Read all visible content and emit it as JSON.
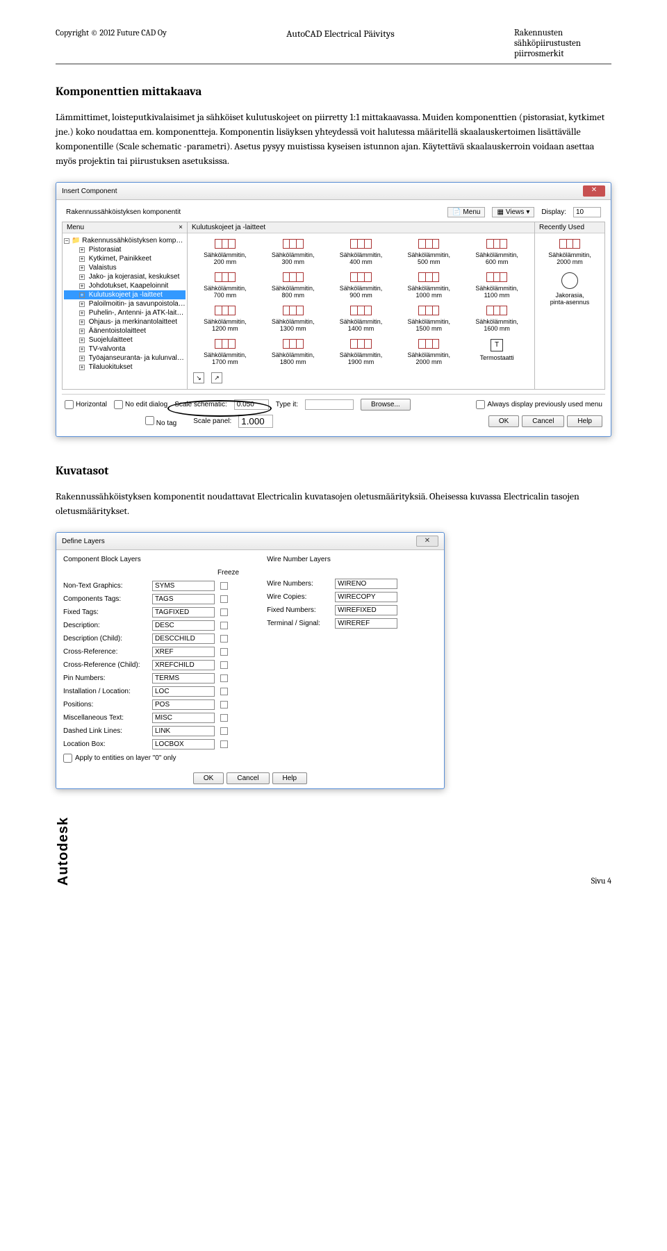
{
  "header": {
    "copyright": "Copyright © 2012 Future CAD Oy",
    "title": "AutoCAD Electrical Päivitys",
    "subtitle": "Rakennusten sähköpiirustusten piirrosmerkit"
  },
  "section1": {
    "heading": "Komponenttien mittakaava",
    "p1": "Lämmittimet, loisteputkivalaisimet ja sähköiset kulutuskojeet on piirretty 1:1 mittakaavassa. Muiden komponenttien (pistorasiat, kytkimet jne.) koko noudattaa em. komponentteja. Komponentin lisäyksen yhteydessä voit halutessa määritellä skaalauskertoimen lisättävälle komponentille (Scale schematic -parametri). Asetus pysyy muistissa kyseisen istunnon ajan. Käytettävä skaalauskerroin voidaan asettaa myös projektin tai piirustuksen asetuksissa."
  },
  "insert_dialog": {
    "title": "Insert Component",
    "subtitle": "Rakennussähköistyksen komponentit",
    "menu_label": "Menu",
    "views_label": "Views",
    "display_label": "Display:",
    "display_value": "10",
    "menu_head": "Menu",
    "main_head": "Kulutuskojeet ja -laitteet",
    "recent_head": "Recently Used",
    "tree": {
      "root": "Rakennussähköistyksen komponentit",
      "items": [
        "Pistorasiat",
        "Kytkimet, Painikkeet",
        "Valaistus",
        "Jako- ja kojerasiat, keskukset",
        "Johdotukset, Kaapeloinnit",
        "Kulutuskojeet ja -laitteet",
        "Paloilmoitin- ja savunpoistolaitteet",
        "Puhelin-, Antenni- ja ATK-laitteet",
        "Ohjaus- ja merkinantolaitteet",
        "Äänentoistolaitteet",
        "Suojelulaitteet",
        "TV-valvonta",
        "Työajanseuranta- ja kulunvalvonta",
        "Tilaluokitukset"
      ],
      "selected_index": 5
    },
    "components": [
      {
        "l1": "Sähkölämmitin,",
        "l2": "200 mm"
      },
      {
        "l1": "Sähkölämmitin,",
        "l2": "300 mm"
      },
      {
        "l1": "Sähkölämmitin,",
        "l2": "400 mm"
      },
      {
        "l1": "Sähkölämmitin,",
        "l2": "500 mm"
      },
      {
        "l1": "Sähkölämmitin,",
        "l2": "600 mm"
      },
      {
        "l1": "Sähkölämmitin,",
        "l2": "700 mm"
      },
      {
        "l1": "Sähkölämmitin,",
        "l2": "800 mm"
      },
      {
        "l1": "Sähkölämmitin,",
        "l2": "900 mm"
      },
      {
        "l1": "Sähkölämmitin,",
        "l2": "1000 mm"
      },
      {
        "l1": "Sähkölämmitin,",
        "l2": "1100 mm"
      },
      {
        "l1": "Sähkölämmitin,",
        "l2": "1200 mm"
      },
      {
        "l1": "Sähkölämmitin,",
        "l2": "1300 mm"
      },
      {
        "l1": "Sähkölämmitin,",
        "l2": "1400 mm"
      },
      {
        "l1": "Sähkölämmitin,",
        "l2": "1500 mm"
      },
      {
        "l1": "Sähkölämmitin,",
        "l2": "1600 mm"
      },
      {
        "l1": "Sähkölämmitin,",
        "l2": "1700 mm"
      },
      {
        "l1": "Sähkölämmitin,",
        "l2": "1800 mm"
      },
      {
        "l1": "Sähkölämmitin,",
        "l2": "1900 mm"
      },
      {
        "l1": "Sähkölämmitin,",
        "l2": "2000 mm"
      },
      {
        "l1": "Termostaatti",
        "l2": "",
        "t": true
      }
    ],
    "recent": [
      {
        "l1": "Sähkölämmitin,",
        "l2": "2000 mm",
        "type": "heater"
      },
      {
        "l1": "Jakorasia,",
        "l2": "pinta-asennus",
        "type": "circle"
      }
    ],
    "bottom": {
      "horizontal": "Horizontal",
      "noedit": "No edit dialog",
      "notag": "No tag",
      "scale_schematic_label": "Scale schematic:",
      "scale_schematic_value": "0.050",
      "scale_panel_label": "Scale panel:",
      "scale_panel_value": "1.000",
      "type_it": "Type it:",
      "browse": "Browse...",
      "always": "Always display previously used menu",
      "ok": "OK",
      "cancel": "Cancel",
      "help": "Help"
    }
  },
  "section2": {
    "heading": "Kuvatasot",
    "p1": "Rakennussähköistyksen komponentit noudattavat Electricalin kuvatasojen oletusmäärityksiä. Oheisessa kuvassa Electricalin tasojen oletusmääritykset."
  },
  "define_layers": {
    "title": "Define Layers",
    "left_head": "Component Block Layers",
    "right_head": "Wire Number Layers",
    "freeze": "Freeze",
    "left_rows": [
      {
        "label": "Non-Text Graphics:",
        "value": "SYMS"
      },
      {
        "label": "Components Tags:",
        "value": "TAGS"
      },
      {
        "label": "Fixed Tags:",
        "value": "TAGFIXED"
      },
      {
        "label": "Description:",
        "value": "DESC"
      },
      {
        "label": "Description (Child):",
        "value": "DESCCHILD"
      },
      {
        "label": "Cross-Reference:",
        "value": "XREF"
      },
      {
        "label": "Cross-Reference (Child):",
        "value": "XREFCHILD"
      },
      {
        "label": "Pin Numbers:",
        "value": "TERMS"
      },
      {
        "label": "Installation / Location:",
        "value": "LOC"
      },
      {
        "label": "Positions:",
        "value": "POS"
      },
      {
        "label": "Miscellaneous Text:",
        "value": "MISC"
      },
      {
        "label": "Dashed Link Lines:",
        "value": "LINK"
      },
      {
        "label": "Location Box:",
        "value": "LOCBOX"
      }
    ],
    "right_rows": [
      {
        "label": "Wire Numbers:",
        "value": "WIRENO"
      },
      {
        "label": "Wire Copies:",
        "value": "WIRECOPY"
      },
      {
        "label": "Fixed Numbers:",
        "value": "WIREFIXED"
      },
      {
        "label": "Terminal / Signal:",
        "value": "WIREREF"
      }
    ],
    "apply": "Apply to entities on layer \"0\" only",
    "ok": "OK",
    "cancel": "Cancel",
    "help": "Help"
  },
  "footer": {
    "brand": "Autodesk",
    "page": "Sivu 4"
  }
}
